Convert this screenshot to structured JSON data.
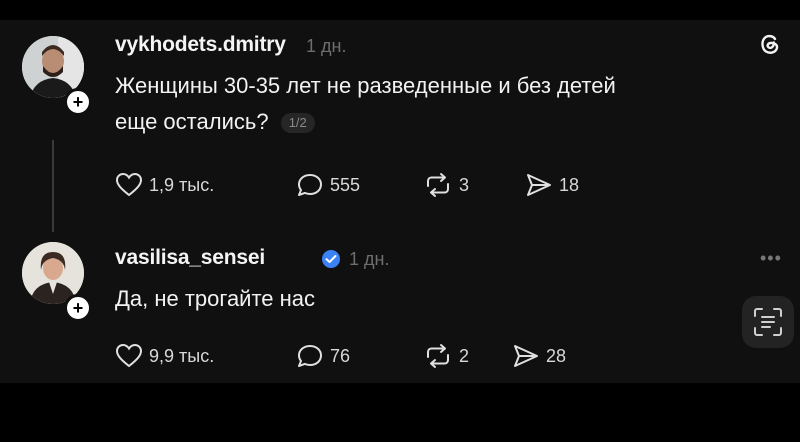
{
  "posts": [
    {
      "username": "vykhodets.dmitry",
      "time": "1 дн.",
      "text_line1": "Женщины 30-35 лет не разведенные и без детей",
      "text_line2": "еще остались?",
      "page_badge": "1/2",
      "likes": "1,9 тыс.",
      "comments": "555",
      "reposts": "3",
      "shares": "18"
    },
    {
      "username": "vasilisa_sensei",
      "time": "1 дн.",
      "text": "Да, не трогайте нас",
      "likes": "9,9 тыс.",
      "comments": "76",
      "reposts": "2",
      "shares": "28"
    }
  ],
  "icons": {
    "threads_logo": "threads-logo-icon",
    "more": "more-dots-icon",
    "scan": "scan-text-icon",
    "like": "heart-icon",
    "comment": "comment-bubble-icon",
    "repost": "repost-icon",
    "share": "send-icon",
    "verified": "verified-badge-icon"
  },
  "colors": {
    "background": "#101010",
    "text": "#f2f2f2",
    "muted": "#6e6e6e",
    "verified": "#3b82f6"
  }
}
